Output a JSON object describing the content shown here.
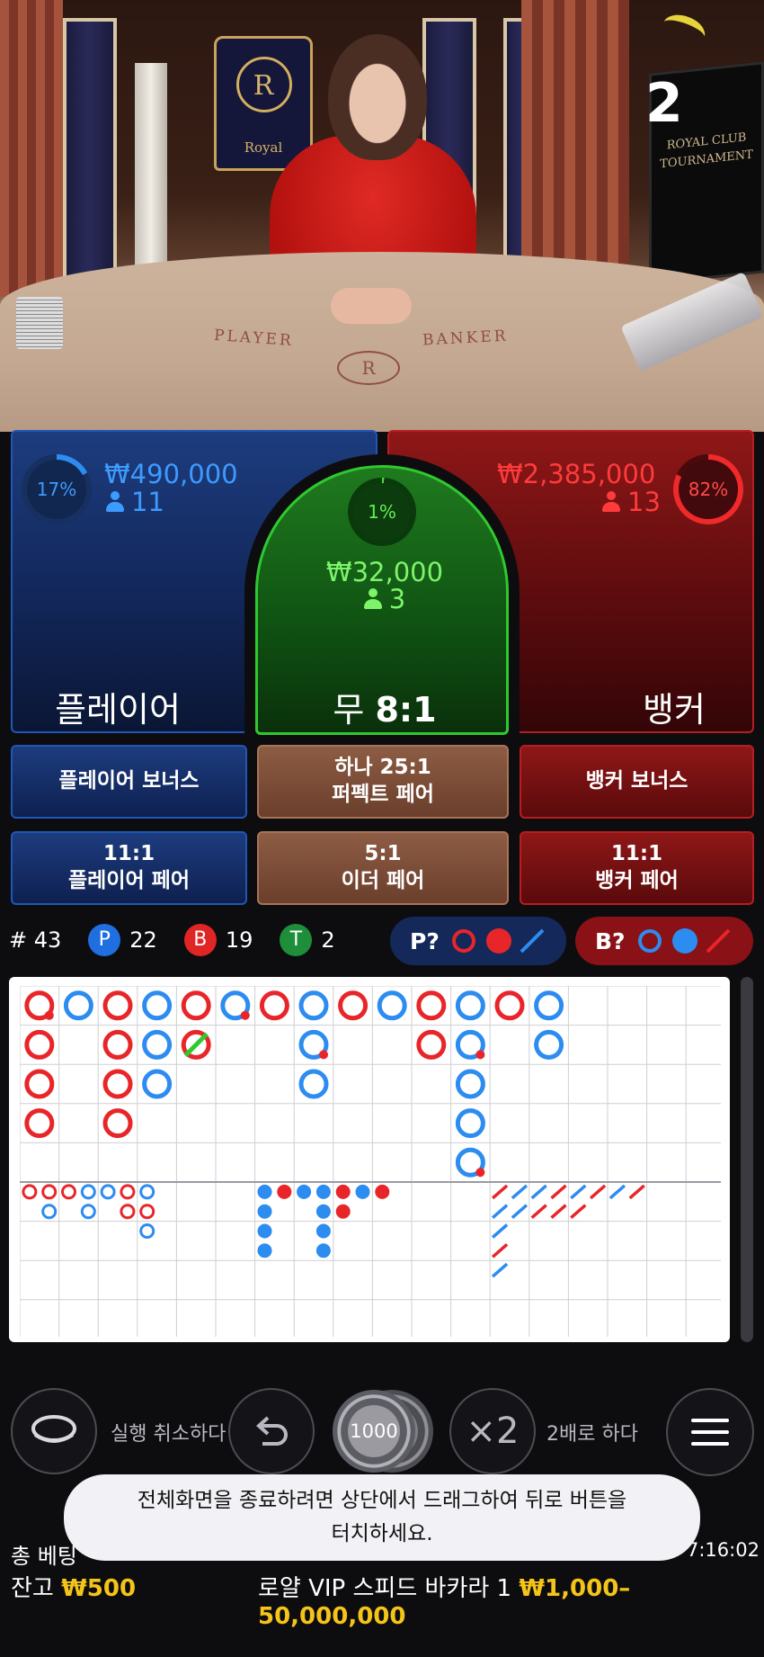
{
  "timer": "2",
  "video": {
    "emblem_letter": "R",
    "emblem_text": "Royal",
    "monitor_line1": "ROYAL CLUB",
    "monitor_line2": "TOURNAMENT",
    "table_player": "PLAYER",
    "table_banker": "BANKER",
    "table_logo_letter": "R"
  },
  "bets": {
    "player": {
      "percent": "17%",
      "amount": "₩490,000",
      "count": "11",
      "label": "플레이어",
      "percent_value": 17
    },
    "tie": {
      "percent": "1%",
      "amount": "₩32,000",
      "count": "3",
      "label": "무",
      "payout": "8:1",
      "percent_value": 1
    },
    "banker": {
      "percent": "82%",
      "amount": "₩2,385,000",
      "count": "13",
      "label": "뱅커",
      "percent_value": 82
    }
  },
  "side_bets": {
    "player_bonus": "플레이어 보너스",
    "perfect_pair_odds": "하나 25:1",
    "perfect_pair": "퍼펙트 페어",
    "banker_bonus": "뱅커 보너스",
    "player_pair_odds": "11:1",
    "player_pair": "플레이어 페어",
    "either_pair_odds": "5:1",
    "either_pair": "이더 페어",
    "banker_pair_odds": "11:1",
    "banker_pair": "뱅커 페어"
  },
  "stats": {
    "hand_count": "# 43",
    "p_letter": "P",
    "p_count": "22",
    "b_letter": "B",
    "b_count": "19",
    "t_letter": "T",
    "t_count": "2",
    "predict_player": "P?",
    "predict_banker": "B?"
  },
  "colors": {
    "player": "#2d8cf0",
    "banker": "#e8262a",
    "tie": "#2fc92f",
    "gold": "#f5c418"
  },
  "roadmap": {
    "big_road": [
      [
        "B",
        "B",
        "B",
        "B"
      ],
      [
        "P"
      ],
      [
        "B",
        "B",
        "B",
        "B"
      ],
      [
        "P",
        "P",
        "P"
      ],
      [
        "B",
        "B"
      ],
      [
        "P"
      ],
      [
        "B"
      ],
      [
        "P",
        "P",
        "P"
      ],
      [
        "B"
      ],
      [
        "P"
      ],
      [
        "B",
        "B"
      ],
      [
        "P",
        "P",
        "P",
        "P",
        "P"
      ],
      [
        "B"
      ],
      [
        "P",
        "P"
      ]
    ],
    "tie_marked": [
      [
        4,
        1
      ]
    ],
    "pair_marks": [
      [
        0,
        0,
        "B"
      ],
      [
        5,
        0,
        "B"
      ],
      [
        7,
        1,
        "B"
      ],
      [
        11,
        1,
        "B"
      ],
      [
        11,
        4,
        "B"
      ]
    ],
    "small_rings": [
      [
        "B"
      ],
      [
        "B",
        "P"
      ],
      [
        "B"
      ],
      [
        "P",
        "P"
      ],
      [
        "P"
      ],
      [
        "B",
        "B"
      ],
      [
        "P",
        "B",
        "P"
      ]
    ],
    "bead_dots": [
      [
        "P",
        "P",
        "P",
        "P"
      ],
      [
        "B"
      ],
      [
        "P"
      ],
      [
        "P",
        "P",
        "P",
        "P"
      ],
      [
        "B",
        "B"
      ],
      [
        "P"
      ],
      [
        "B"
      ]
    ],
    "cockroach": [
      [
        "B",
        "P",
        "P",
        "B",
        "P"
      ],
      [
        "P",
        "P"
      ],
      [
        "P",
        "B"
      ],
      [
        "B",
        "B"
      ],
      [
        "P",
        "B"
      ],
      [
        "B"
      ],
      [
        "P"
      ],
      [
        "B"
      ]
    ]
  },
  "controls": {
    "undo_all": "실행 취소하다",
    "chip_value": "1000",
    "double_symbol": "×2",
    "double": "2배로 하다"
  },
  "footer": {
    "toast_line1": "전체화면을 종료하려면 상단에서 드래그하여 뒤로 버튼을",
    "toast_line2": "터치하세요.",
    "total_bet_label": "총 베팅",
    "clock": "7:16:02",
    "balance_label": "잔고",
    "balance_value": "₩500",
    "table_name": "로얄 VIP 스피드 바카라 1",
    "limits": "₩1,000–50,000,000"
  }
}
